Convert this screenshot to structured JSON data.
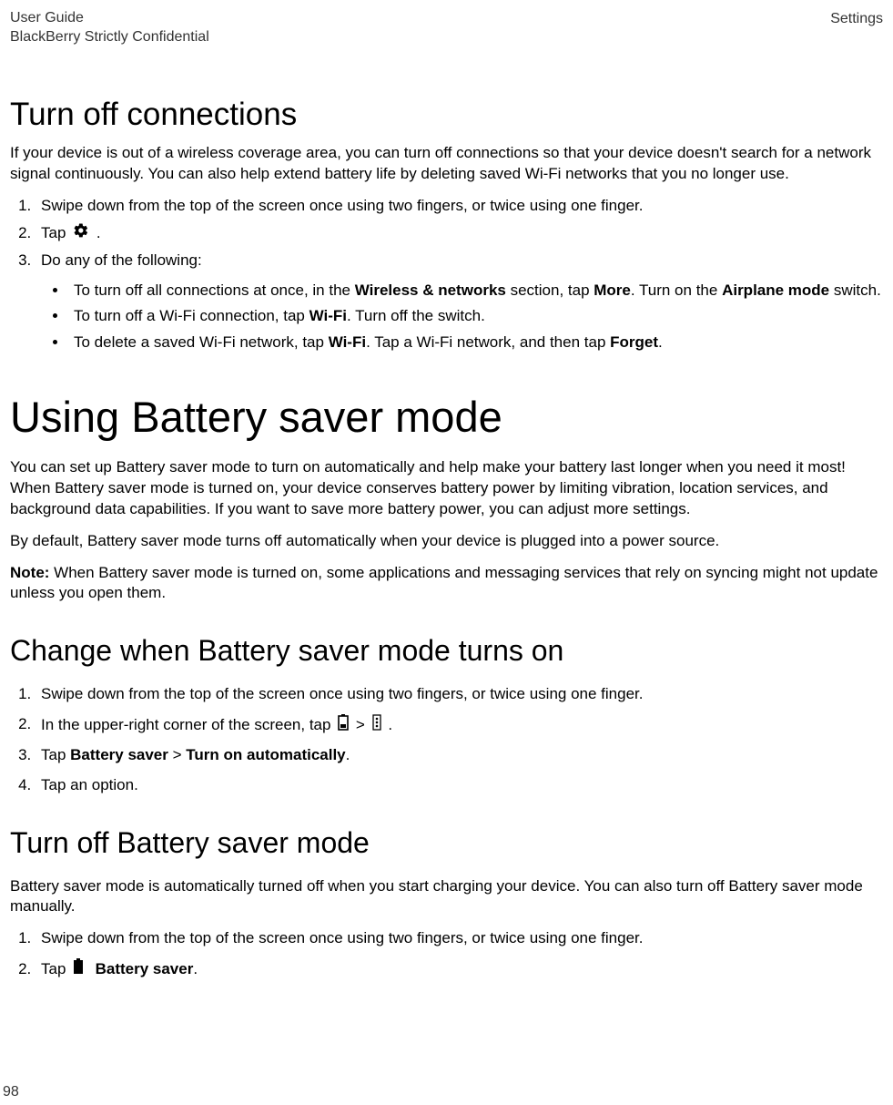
{
  "header": {
    "left1": "User Guide",
    "left2": "BlackBerry Strictly Confidential",
    "right": "Settings"
  },
  "s1": {
    "title": "Turn off connections",
    "intro": "If your device is out of a wireless coverage area, you can turn off connections so that your device doesn't search for a network signal continuously. You can also help extend battery life by deleting saved Wi-Fi networks that you no longer use.",
    "step1": "Swipe down from the top of the screen once using two fingers, or twice using one finger.",
    "step2a": "Tap ",
    "step2b": " .",
    "step3": "Do any of the following:",
    "b1a": "To turn off all connections at once, in the ",
    "b1b": "Wireless & networks",
    "b1c": " section, tap ",
    "b1d": "More",
    "b1e": ". Turn on the ",
    "b1f": "Airplane mode",
    "b1g": " switch.",
    "b2a": "To turn off a Wi-Fi connection, tap ",
    "b2b": "Wi-Fi",
    "b2c": ". Turn off the switch.",
    "b3a": "To delete a saved Wi-Fi network, tap ",
    "b3b": "Wi-Fi",
    "b3c": ". Tap a Wi-Fi network, and then tap ",
    "b3d": "Forget",
    "b3e": "."
  },
  "s2": {
    "title": "Using Battery saver mode",
    "p1": "You can set up Battery saver mode to turn on automatically and help make your battery last longer when you need it most! When Battery saver mode is turned on, your device conserves battery power by limiting vibration, location services, and background data capabilities. If you want to save more battery power, you can adjust more settings.",
    "p2": "By default, Battery saver mode turns off automatically when your device is plugged into a power source.",
    "noteLabel": "Note:",
    "noteText": " When Battery saver mode is turned on, some applications and messaging services that rely on syncing might not update unless you open them."
  },
  "s3": {
    "title": "Change when Battery saver mode turns on",
    "step1": "Swipe down from the top of the screen once using two fingers, or twice using one finger.",
    "step2a": "In the upper-right corner of the screen, tap ",
    "step2gt": " > ",
    "step2b": " .",
    "step3a": "Tap ",
    "step3b": "Battery saver",
    "step3c": " > ",
    "step3d": "Turn on automatically",
    "step3e": ".",
    "step4": "Tap an option."
  },
  "s4": {
    "title": "Turn off Battery saver mode",
    "intro": "Battery saver mode is automatically turned off when you start charging your device. You can also turn off Battery saver mode manually.",
    "step1": "Swipe down from the top of the screen once using two fingers, or twice using one finger.",
    "step2a": "Tap ",
    "step2b": "Battery saver",
    "step2c": "."
  },
  "pageNumber": "98"
}
